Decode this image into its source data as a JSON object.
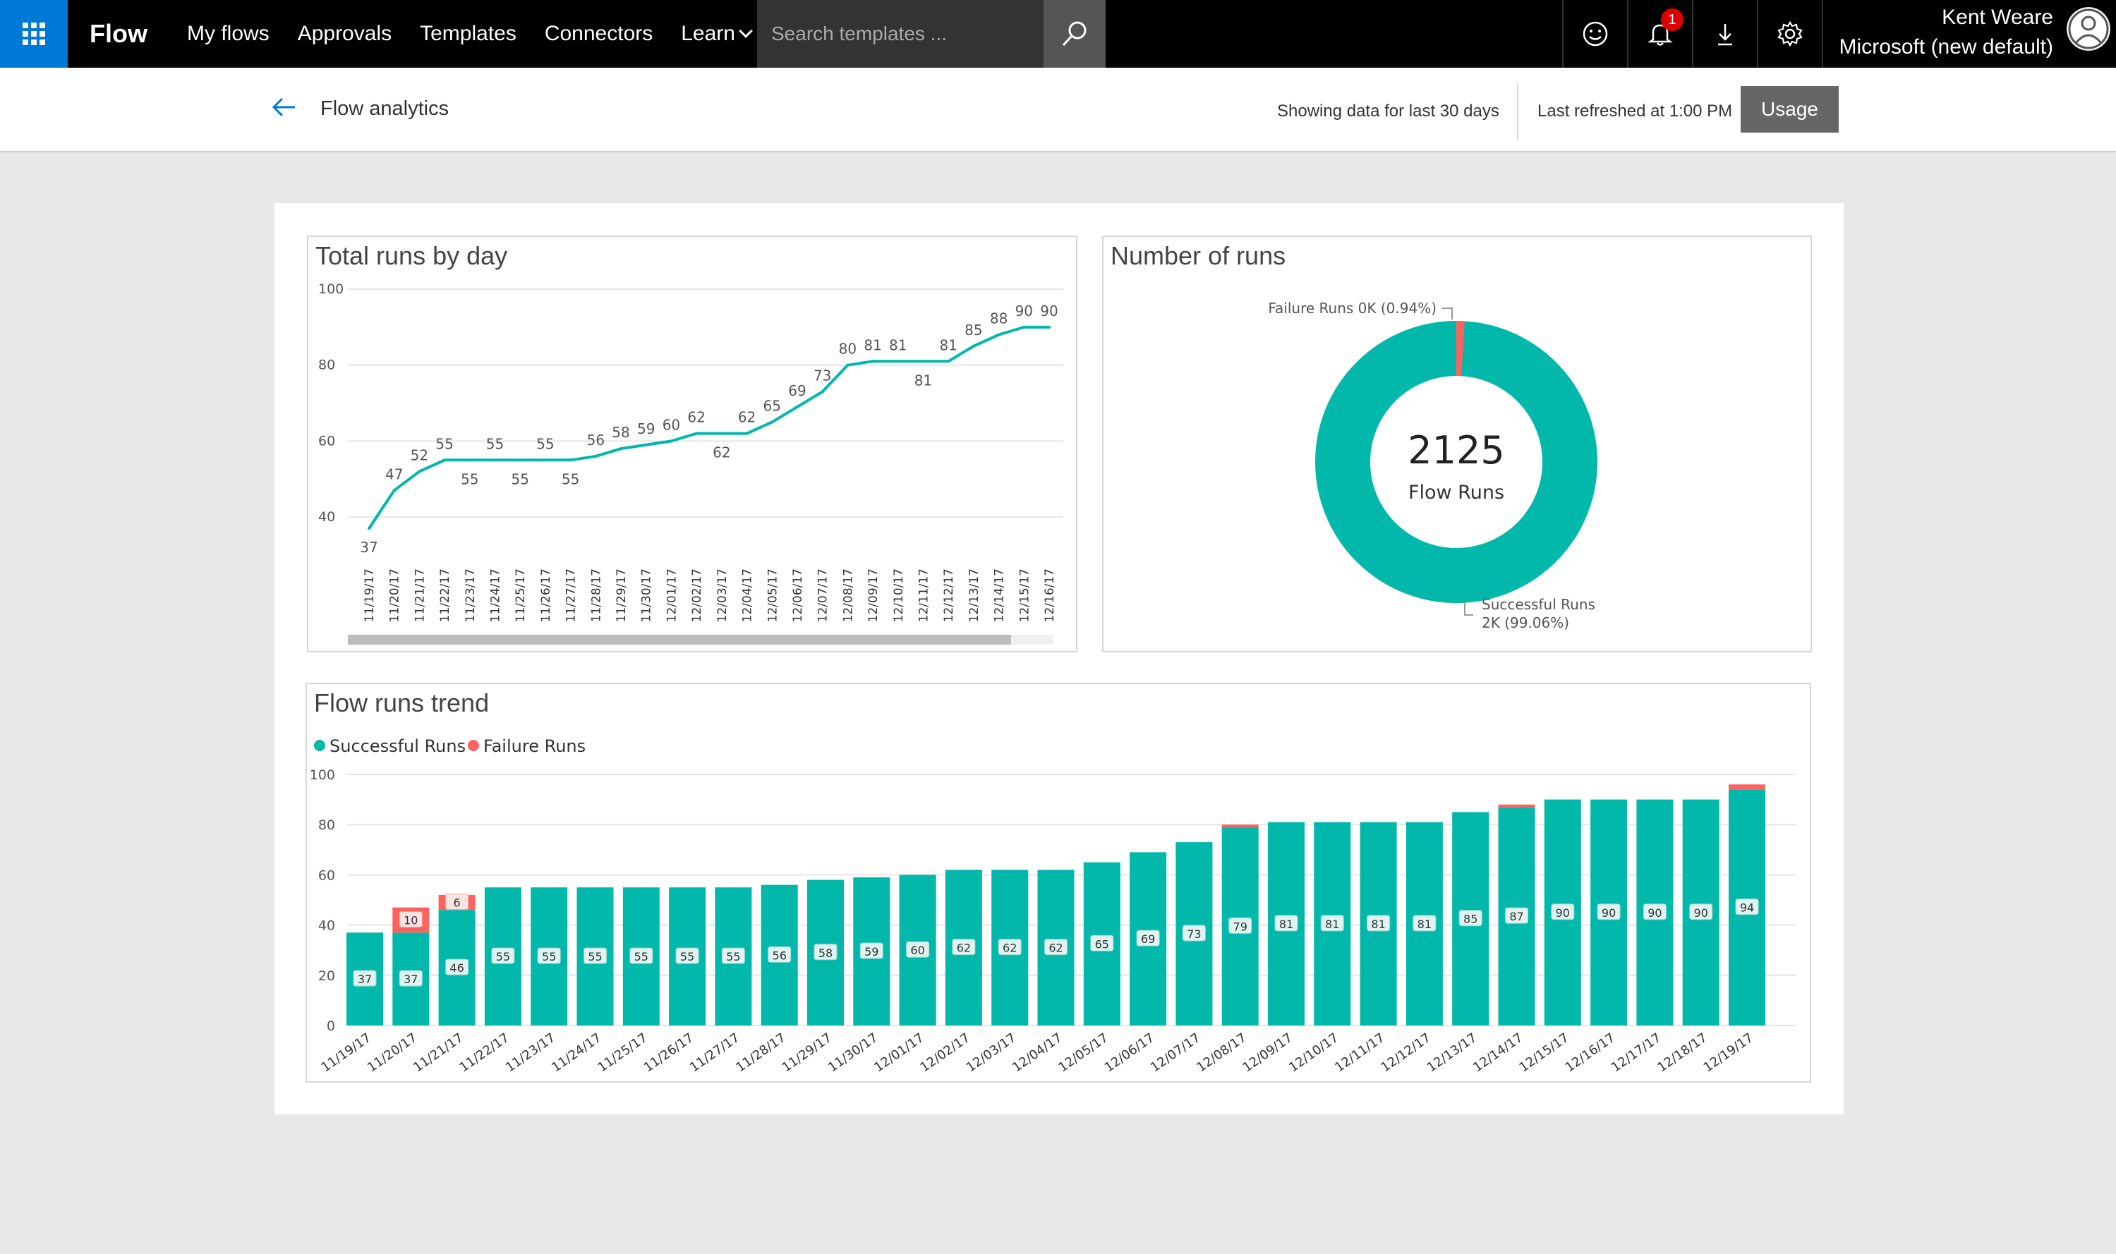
{
  "app": {
    "brand": "Flow",
    "nav": [
      "My flows",
      "Approvals",
      "Templates",
      "Connectors",
      "Learn"
    ],
    "search_placeholder": "Search templates ...",
    "notification_count": "1",
    "user_name": "Kent Weare",
    "user_org": "Microsoft (new default)",
    "icons": [
      "app-launcher-icon",
      "search-icon",
      "smiley-icon",
      "bell-icon",
      "download-icon",
      "gear-icon",
      "avatar-icon"
    ]
  },
  "subheader": {
    "title": "Flow analytics",
    "showing": "Showing data for last 30 days",
    "refreshed": "Last refreshed at 1:00 PM",
    "usage_button": "Usage"
  },
  "colors": {
    "success": "#01b8aa",
    "failure": "#fd625e",
    "accent": "#0078d7"
  },
  "chart_data": [
    {
      "type": "line",
      "title": "Total runs by day",
      "x": [
        "11/19/17",
        "11/20/17",
        "11/21/17",
        "11/22/17",
        "11/23/17",
        "11/24/17",
        "11/25/17",
        "11/26/17",
        "11/27/17",
        "11/28/17",
        "11/29/17",
        "11/30/17",
        "12/01/17",
        "12/02/17",
        "12/03/17",
        "12/04/17",
        "12/05/17",
        "12/06/17",
        "12/07/17",
        "12/08/17",
        "12/09/17",
        "12/10/17",
        "12/11/17",
        "12/12/17",
        "12/13/17",
        "12/14/17",
        "12/15/17",
        "12/16/17"
      ],
      "values": [
        37,
        47,
        52,
        55,
        55,
        55,
        55,
        55,
        55,
        56,
        58,
        59,
        60,
        62,
        62,
        62,
        65,
        69,
        73,
        80,
        81,
        81,
        81,
        81,
        85,
        88,
        90,
        90
      ],
      "yticks": [
        "40",
        "60",
        "80",
        "100"
      ],
      "ylim": [
        35,
        100
      ],
      "grid": true
    },
    {
      "type": "pie",
      "title": "Number of runs",
      "center_value": "2125",
      "center_label": "Flow Runs",
      "slices": [
        {
          "name": "Successful Runs",
          "value": 99.06,
          "label_line1": "Successful Runs",
          "label_line2": "2K (99.06%)"
        },
        {
          "name": "Failure Runs",
          "value": 0.94,
          "label_line1": "Failure Runs 0K (0.94%)"
        }
      ]
    },
    {
      "type": "bar",
      "title": "Flow runs trend",
      "legend": [
        "Successful Runs",
        "Failure Runs"
      ],
      "categories": [
        "11/19/17",
        "11/20/17",
        "11/21/17",
        "11/22/17",
        "11/23/17",
        "11/24/17",
        "11/25/17",
        "11/26/17",
        "11/27/17",
        "11/28/17",
        "11/29/17",
        "11/30/17",
        "12/01/17",
        "12/02/17",
        "12/03/17",
        "12/04/17",
        "12/05/17",
        "12/06/17",
        "12/07/17",
        "12/08/17",
        "12/09/17",
        "12/10/17",
        "12/11/17",
        "12/12/17",
        "12/13/17",
        "12/14/17",
        "12/15/17",
        "12/16/17",
        "12/17/17",
        "12/18/17",
        "12/19/17"
      ],
      "series": [
        {
          "name": "Successful Runs",
          "values": [
            37,
            37,
            46,
            55,
            55,
            55,
            55,
            55,
            55,
            56,
            58,
            59,
            60,
            62,
            62,
            62,
            65,
            69,
            73,
            79,
            81,
            81,
            81,
            81,
            85,
            87,
            90,
            90,
            90,
            90,
            94
          ]
        },
        {
          "name": "Failure Runs",
          "values": [
            0,
            10,
            6,
            0,
            0,
            0,
            0,
            0,
            0,
            0,
            0,
            0,
            0,
            0,
            0,
            0,
            0,
            0,
            0,
            1,
            0,
            0,
            0,
            0,
            0,
            1,
            0,
            0,
            0,
            0,
            2
          ]
        }
      ],
      "yticks": [
        "0",
        "20",
        "40",
        "60",
        "80",
        "100"
      ],
      "ylim": [
        0,
        100
      ],
      "grid": true
    }
  ]
}
